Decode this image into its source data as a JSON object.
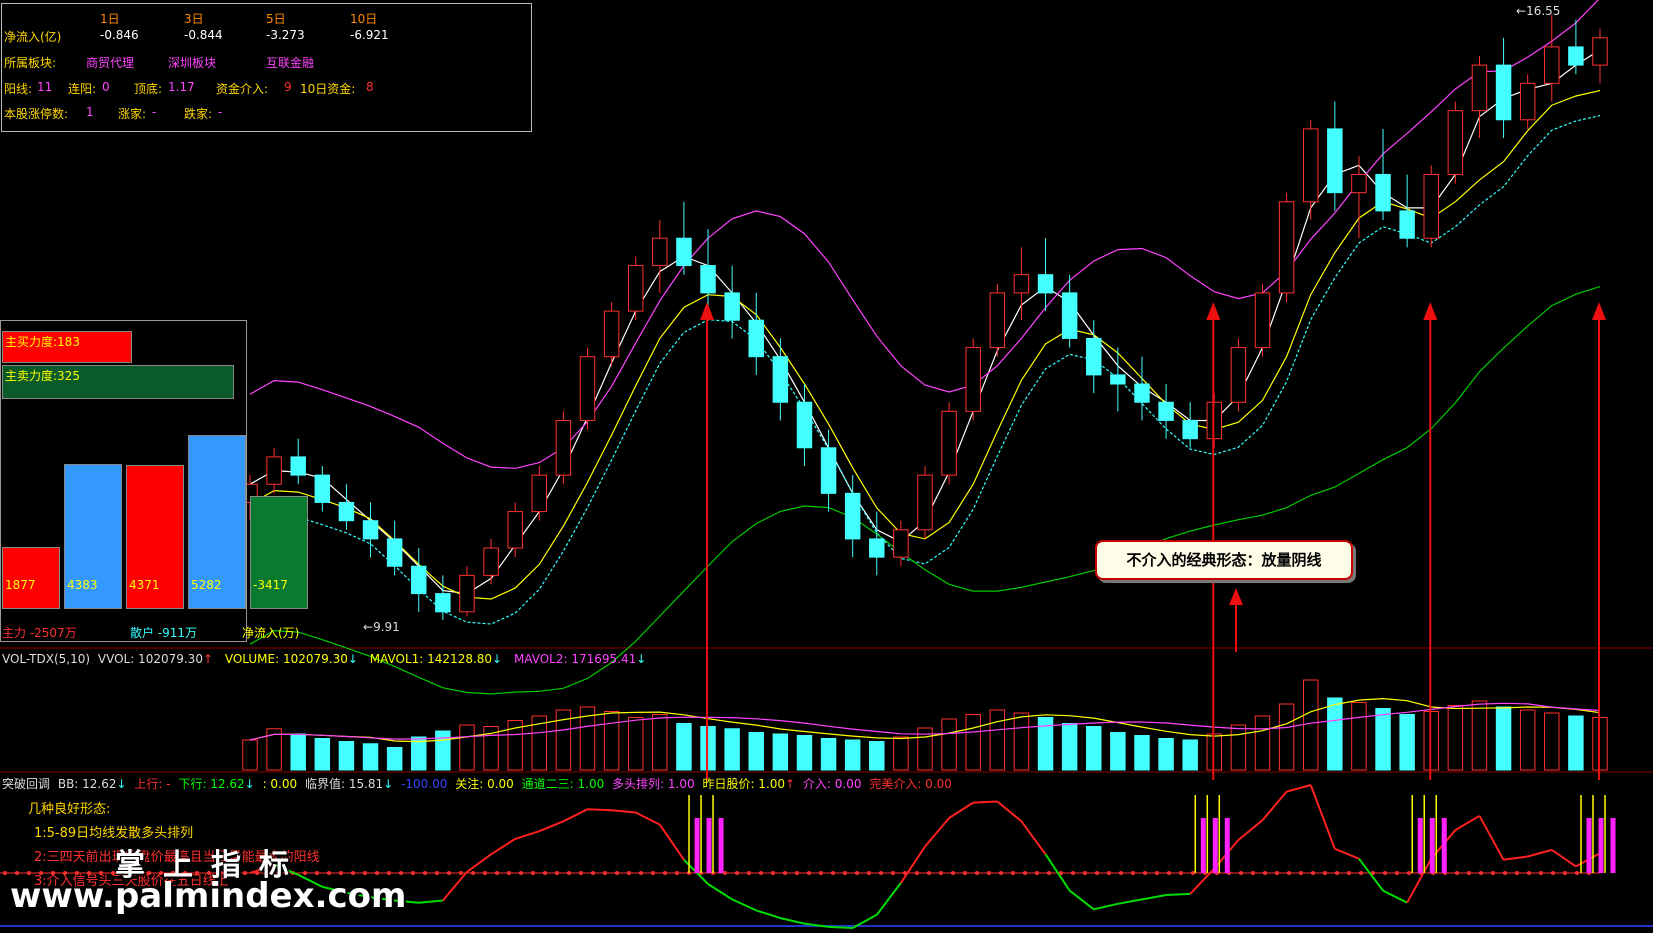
{
  "info_panel": {
    "net_inflow_label": "净流入(亿)",
    "periods": [
      "1日",
      "3日",
      "5日",
      "10日"
    ],
    "net_inflow_values": [
      "-0.846",
      "-0.844",
      "-3.273",
      "-6.921"
    ],
    "sector_label": "所属板块:",
    "sectors": [
      "商贸代理",
      "深圳板块",
      "互联金融"
    ],
    "yang_label": "阳线:",
    "yang_value": "11",
    "lianyang_label": "连阳:",
    "lianyang_value": "0",
    "dingdi_label": "顶底:",
    "dingdi_value": "1.17",
    "capital_label": "资金介入:",
    "capital_value": "9",
    "capital10_label": "10日资金:",
    "capital10_value": "8",
    "limitup_label": "本股涨停数:",
    "limitup_value": "1",
    "up_label": "涨家:",
    "up_value": "-",
    "down_label": "跌家:",
    "down_value": "-"
  },
  "force_panel": {
    "buy_label": "主买力度:183",
    "sell_label": "主卖力度:325",
    "bars": [
      {
        "label": "1877",
        "value": 1877,
        "color": "#ff0000"
      },
      {
        "label": "4383",
        "value": 4383,
        "color": "#3399ff"
      },
      {
        "label": "4371",
        "value": 4371,
        "color": "#ff0000"
      },
      {
        "label": "5282",
        "value": 5282,
        "color": "#3399ff"
      },
      {
        "label": "-3417",
        "value": -3417,
        "color": "#0a7a30"
      }
    ],
    "main_label": "主力 -2507万",
    "retail_label": "散户 -911万",
    "net_label": "净流入(万)"
  },
  "price_labels": {
    "high": "16.55",
    "low": "9.91"
  },
  "callout": "不介入的经典形态：放量阴线",
  "vol_legend": {
    "name": "VOL-TDX(5,10)",
    "vvol": "VVOL: 102079.30",
    "volume": "VOLUME: 102079.30",
    "mavol1": "MAVOL1: 142128.80",
    "mavol2": "MAVOL2: 171695.41"
  },
  "ind_legend": {
    "name": "突破回调",
    "bb": "BB: 12.62",
    "up": "上行: -",
    "down": "下行: 12.62",
    "zero": ": 0.00",
    "critical": "临界值: 15.81",
    "neg": "-100.00",
    "focus": "关注: 0.00",
    "channel": "通道二三: 1.00",
    "bull": "多头排列: 1.00",
    "yesterday": "昨日股价: 1.00",
    "enter": "介入: 0.00",
    "perfect": "完美介入: 0.00"
  },
  "notes": {
    "title": "几种良好形态:",
    "n1": "1:5-89日均线发散多头排列",
    "n2": "2:三四天前出现收盘价最高且当日量能最大的阳线",
    "n3": "3:介入信号头三天股价在五日线上"
  },
  "watermark": {
    "cn": "掌上指标",
    "url": "www.palmindex.com"
  },
  "chart_data": {
    "type": "candlestick",
    "title": "",
    "candles": [
      [
        11.2,
        11.5,
        11.0,
        11.4
      ],
      [
        11.4,
        11.8,
        11.3,
        11.7
      ],
      [
        11.7,
        11.9,
        11.4,
        11.5
      ],
      [
        11.5,
        11.6,
        11.1,
        11.2
      ],
      [
        11.2,
        11.4,
        10.9,
        11.0
      ],
      [
        11.0,
        11.2,
        10.6,
        10.8
      ],
      [
        10.8,
        11.0,
        10.4,
        10.5
      ],
      [
        10.5,
        10.7,
        10.0,
        10.2
      ],
      [
        10.2,
        10.4,
        9.91,
        10.0
      ],
      [
        10.0,
        10.5,
        9.95,
        10.4
      ],
      [
        10.4,
        10.8,
        10.3,
        10.7
      ],
      [
        10.7,
        11.2,
        10.6,
        11.1
      ],
      [
        11.1,
        11.6,
        11.0,
        11.5
      ],
      [
        11.5,
        12.2,
        11.4,
        12.1
      ],
      [
        12.1,
        12.9,
        12.0,
        12.8
      ],
      [
        12.8,
        13.4,
        12.7,
        13.3
      ],
      [
        13.3,
        13.9,
        13.2,
        13.8
      ],
      [
        13.8,
        14.3,
        13.5,
        14.1
      ],
      [
        14.1,
        14.5,
        13.7,
        13.8
      ],
      [
        13.8,
        14.2,
        13.3,
        13.5
      ],
      [
        13.5,
        13.8,
        13.0,
        13.2
      ],
      [
        13.2,
        13.5,
        12.6,
        12.8
      ],
      [
        12.8,
        13.0,
        12.1,
        12.3
      ],
      [
        12.3,
        12.5,
        11.6,
        11.8
      ],
      [
        11.8,
        12.0,
        11.1,
        11.3
      ],
      [
        11.3,
        11.5,
        10.6,
        10.8
      ],
      [
        10.8,
        11.1,
        10.4,
        10.6
      ],
      [
        10.6,
        11.0,
        10.5,
        10.9
      ],
      [
        10.9,
        11.6,
        10.8,
        11.5
      ],
      [
        11.5,
        12.3,
        11.4,
        12.2
      ],
      [
        12.2,
        13.0,
        12.1,
        12.9
      ],
      [
        12.9,
        13.6,
        12.8,
        13.5
      ],
      [
        13.5,
        14.0,
        13.2,
        13.7
      ],
      [
        13.7,
        14.1,
        13.3,
        13.5
      ],
      [
        13.5,
        13.7,
        12.9,
        13.0
      ],
      [
        13.0,
        13.2,
        12.4,
        12.6
      ],
      [
        12.6,
        12.9,
        12.2,
        12.5
      ],
      [
        12.5,
        12.8,
        12.1,
        12.3
      ],
      [
        12.3,
        12.5,
        11.9,
        12.1
      ],
      [
        12.1,
        12.3,
        11.8,
        11.9
      ],
      [
        11.9,
        12.4,
        11.8,
        12.3
      ],
      [
        12.3,
        13.0,
        12.2,
        12.9
      ],
      [
        12.9,
        13.6,
        12.8,
        13.5
      ],
      [
        13.5,
        14.6,
        13.4,
        14.5
      ],
      [
        14.5,
        15.4,
        14.3,
        15.3
      ],
      [
        15.3,
        15.6,
        14.4,
        14.6
      ],
      [
        14.6,
        15.0,
        14.1,
        14.8
      ],
      [
        14.8,
        15.3,
        14.3,
        14.4
      ],
      [
        14.4,
        14.8,
        14.0,
        14.1
      ],
      [
        14.1,
        14.9,
        14.0,
        14.8
      ],
      [
        14.8,
        15.6,
        14.7,
        15.5
      ],
      [
        15.5,
        16.1,
        15.2,
        16.0
      ],
      [
        16.0,
        16.3,
        15.2,
        15.4
      ],
      [
        15.4,
        15.9,
        15.3,
        15.8
      ],
      [
        15.8,
        16.55,
        15.6,
        16.2
      ],
      [
        16.2,
        16.5,
        15.9,
        16.0
      ],
      [
        16.0,
        16.4,
        15.8,
        16.3
      ]
    ],
    "volume": [
      40,
      55,
      48,
      42,
      38,
      35,
      30,
      44,
      52,
      60,
      58,
      66,
      72,
      80,
      84,
      78,
      70,
      74,
      62,
      58,
      55,
      50,
      48,
      46,
      42,
      40,
      38,
      44,
      56,
      68,
      74,
      80,
      76,
      70,
      62,
      58,
      50,
      46,
      42,
      40,
      48,
      60,
      72,
      88,
      120,
      96,
      90,
      82,
      74,
      78,
      86,
      92,
      84,
      80,
      76,
      72,
      70
    ],
    "ylim": [
      9.91,
      16.55
    ],
    "grid": false
  }
}
